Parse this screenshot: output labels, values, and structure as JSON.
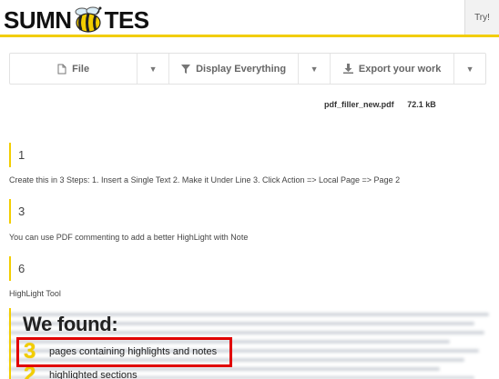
{
  "header": {
    "logo_left": "SUMN",
    "logo_right": "TES",
    "try_label": "Try!"
  },
  "toolbar": {
    "file_label": "File",
    "display_label": "Display Everything",
    "export_label": "Export your work"
  },
  "file": {
    "name": "pdf_filler_new.pdf",
    "size": "72.1 kB"
  },
  "pages": [
    {
      "number": "1",
      "description": "Create this in 3 Steps: 1. Insert a Single Text 2. Make it Under Line 3. Click Action => Local Page => Page 2"
    },
    {
      "number": "3",
      "description": "You can use PDF commenting to add a better HighLight with Note"
    },
    {
      "number": "6",
      "description": "HighLight Tool"
    }
  ],
  "found": {
    "title": "We found:",
    "items": [
      {
        "count": "3",
        "label": "pages containing highlights and notes"
      },
      {
        "count": "2",
        "label": "highlighted sections"
      }
    ]
  },
  "colors": {
    "accent": "#f2cd00",
    "highlight_border": "#e10000"
  }
}
